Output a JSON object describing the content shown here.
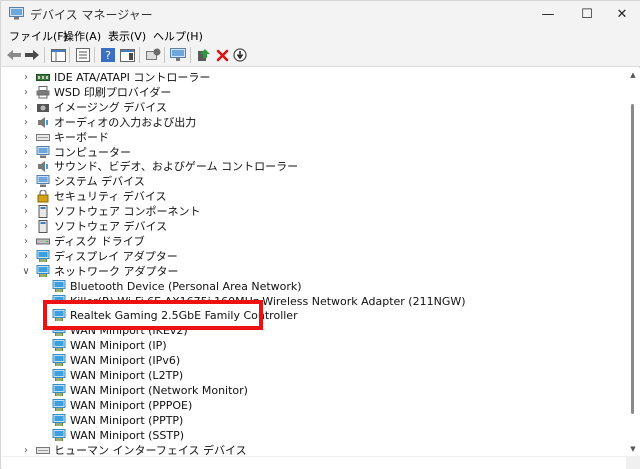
{
  "window": {
    "title": "デバイス マネージャー",
    "minimize_glyph": "—",
    "maximize_glyph": "☐",
    "close_glyph": "✕"
  },
  "menu": {
    "items": [
      "ファイル(F)",
      "操作(A)",
      "表示(V)",
      "ヘルプ(H)"
    ]
  },
  "toolbar": {
    "buttons": [
      {
        "name": "back-icon",
        "glyph": "⬅"
      },
      {
        "name": "forward-icon",
        "glyph": "➡"
      },
      {
        "name": "console-tree-icon",
        "glyph": "▦"
      },
      {
        "name": "properties-icon",
        "glyph": "▤"
      },
      {
        "name": "help-icon",
        "glyph": "?"
      },
      {
        "name": "action-pane-icon",
        "glyph": "▣"
      },
      {
        "name": "update-driver-icon",
        "glyph": "⟳"
      },
      {
        "name": "scan-hardware-icon",
        "glyph": "🖥"
      },
      {
        "name": "enable-device-icon",
        "glyph": "▲"
      },
      {
        "name": "uninstall-icon",
        "glyph": "✖"
      },
      {
        "name": "disable-device-icon",
        "glyph": "⬇"
      }
    ]
  },
  "tree": {
    "categories": [
      {
        "label": "IDE ATA/ATAPI コントローラー",
        "expanded": false,
        "icon": "ide-controller-icon"
      },
      {
        "label": "WSD 印刷プロバイダー",
        "expanded": false,
        "icon": "printer-icon"
      },
      {
        "label": "イメージング デバイス",
        "expanded": false,
        "icon": "camera-icon"
      },
      {
        "label": "オーディオの入力および出力",
        "expanded": false,
        "icon": "speaker-icon"
      },
      {
        "label": "キーボード",
        "expanded": false,
        "icon": "keyboard-icon"
      },
      {
        "label": "コンピューター",
        "expanded": false,
        "icon": "computer-icon"
      },
      {
        "label": "サウンド、ビデオ、およびゲーム コントローラー",
        "expanded": false,
        "icon": "sound-icon"
      },
      {
        "label": "システム デバイス",
        "expanded": false,
        "icon": "system-device-icon"
      },
      {
        "label": "セキュリティ デバイス",
        "expanded": false,
        "icon": "security-device-icon"
      },
      {
        "label": "ソフトウェア コンポーネント",
        "expanded": false,
        "icon": "software-component-icon"
      },
      {
        "label": "ソフトウェア デバイス",
        "expanded": false,
        "icon": "software-device-icon"
      },
      {
        "label": "ディスク ドライブ",
        "expanded": false,
        "icon": "disk-drive-icon"
      },
      {
        "label": "ディスプレイ アダプター",
        "expanded": false,
        "icon": "display-adapter-icon"
      },
      {
        "label": "ネットワーク アダプター",
        "expanded": true,
        "icon": "network-adapter-icon"
      }
    ],
    "network_children": [
      "Bluetooth Device (Personal Area Network)",
      "Killer(R) Wi-Fi 6E AX1675i 160MHz Wireless Network Adapter (211NGW)",
      "Realtek Gaming 2.5GbE Family Controller",
      "WAN Miniport (IKEv2)",
      "WAN Miniport (IP)",
      "WAN Miniport (IPv6)",
      "WAN Miniport (L2TP)",
      "WAN Miniport (Network Monitor)",
      "WAN Miniport (PPPOE)",
      "WAN Miniport (PPTP)",
      "WAN Miniport (SSTP)"
    ],
    "trailing_category": {
      "label": "ヒューマン インターフェイス デバイス",
      "expanded": false,
      "icon": "hid-icon"
    },
    "highlighted_item": "Realtek Gaming 2.5GbE Family Controller",
    "highlight_color": "#ee1111"
  }
}
